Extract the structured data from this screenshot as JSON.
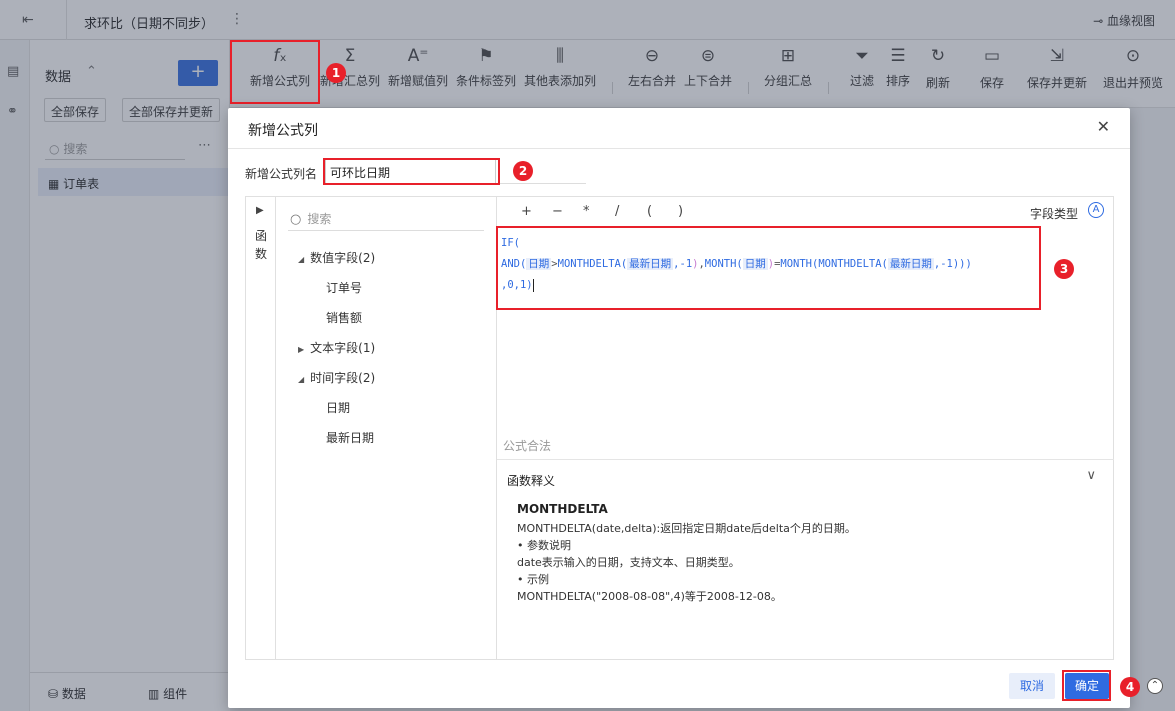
{
  "topbar": {
    "title": "求环比（日期不同步）",
    "lineage_label": "血缘视图"
  },
  "data_panel": {
    "title": "数据",
    "save_all": "全部保存",
    "save_all_update": "全部保存并更新",
    "search_placeholder": "搜索",
    "table_name": "订单表"
  },
  "bottom_tabs": {
    "data": "数据",
    "component": "组件"
  },
  "toolbar": {
    "items": [
      {
        "label": "新增公式列"
      },
      {
        "label": "新增汇总列"
      },
      {
        "label": "新增赋值列"
      },
      {
        "label": "条件标签列"
      },
      {
        "label": "其他表添加列"
      },
      {
        "label": "左右合并"
      },
      {
        "label": "上下合并"
      },
      {
        "label": "分组汇总"
      },
      {
        "label": "过滤"
      },
      {
        "label": "排序"
      }
    ],
    "right": [
      {
        "label": "刷新"
      },
      {
        "label": "保存"
      },
      {
        "label": "保存并更新"
      },
      {
        "label": "退出并预览"
      }
    ]
  },
  "dialog": {
    "title": "新增公式列",
    "name_label": "新增公式列名",
    "name_value": "可环比日期",
    "function_rail": "函数",
    "field_search_placeholder": "搜索",
    "fields": {
      "numeric_group": "数值字段(2)",
      "numeric_items": [
        "订单号",
        "销售额"
      ],
      "text_group": "文本字段(1)",
      "time_group": "时间字段(2)",
      "time_items": [
        "日期",
        "最新日期"
      ]
    },
    "operators": [
      "+",
      "−",
      "*",
      "/",
      "(",
      ")"
    ],
    "field_type_label": "字段类型",
    "formula": {
      "l1_if": "IF(",
      "and": "AND(",
      "f_date": "日期",
      "gt": ">",
      "md1": "MONTHDELTA(",
      "f_latest": "最新日期",
      "neg1": ",-1",
      "close1": ")",
      "comma": ",",
      "month": "MONTH(",
      "close2": ")",
      "eq": "=",
      "month2": "MONTH(",
      "md2": "MONTHDELTA(",
      "tail": ",-1)))",
      "l3": ",0,1)"
    },
    "valid_text": "公式合法",
    "fn_explain_title": "函数释义",
    "fn_name": "MONTHDELTA",
    "fn_desc_lines": [
      "MONTHDELTA(date,delta):返回指定日期date后delta个月的日期。",
      "• 参数说明",
      "date表示输入的日期，支持文本、日期类型。",
      "• 示例",
      "MONTHDELTA(\"2008-08-08\",4)等于2008-12-08。"
    ],
    "cancel": "取消",
    "ok": "确定"
  },
  "marks": [
    "1",
    "2",
    "3",
    "4"
  ],
  "colors": {
    "accent": "#2f6be1",
    "annotation": "#e8202a"
  }
}
